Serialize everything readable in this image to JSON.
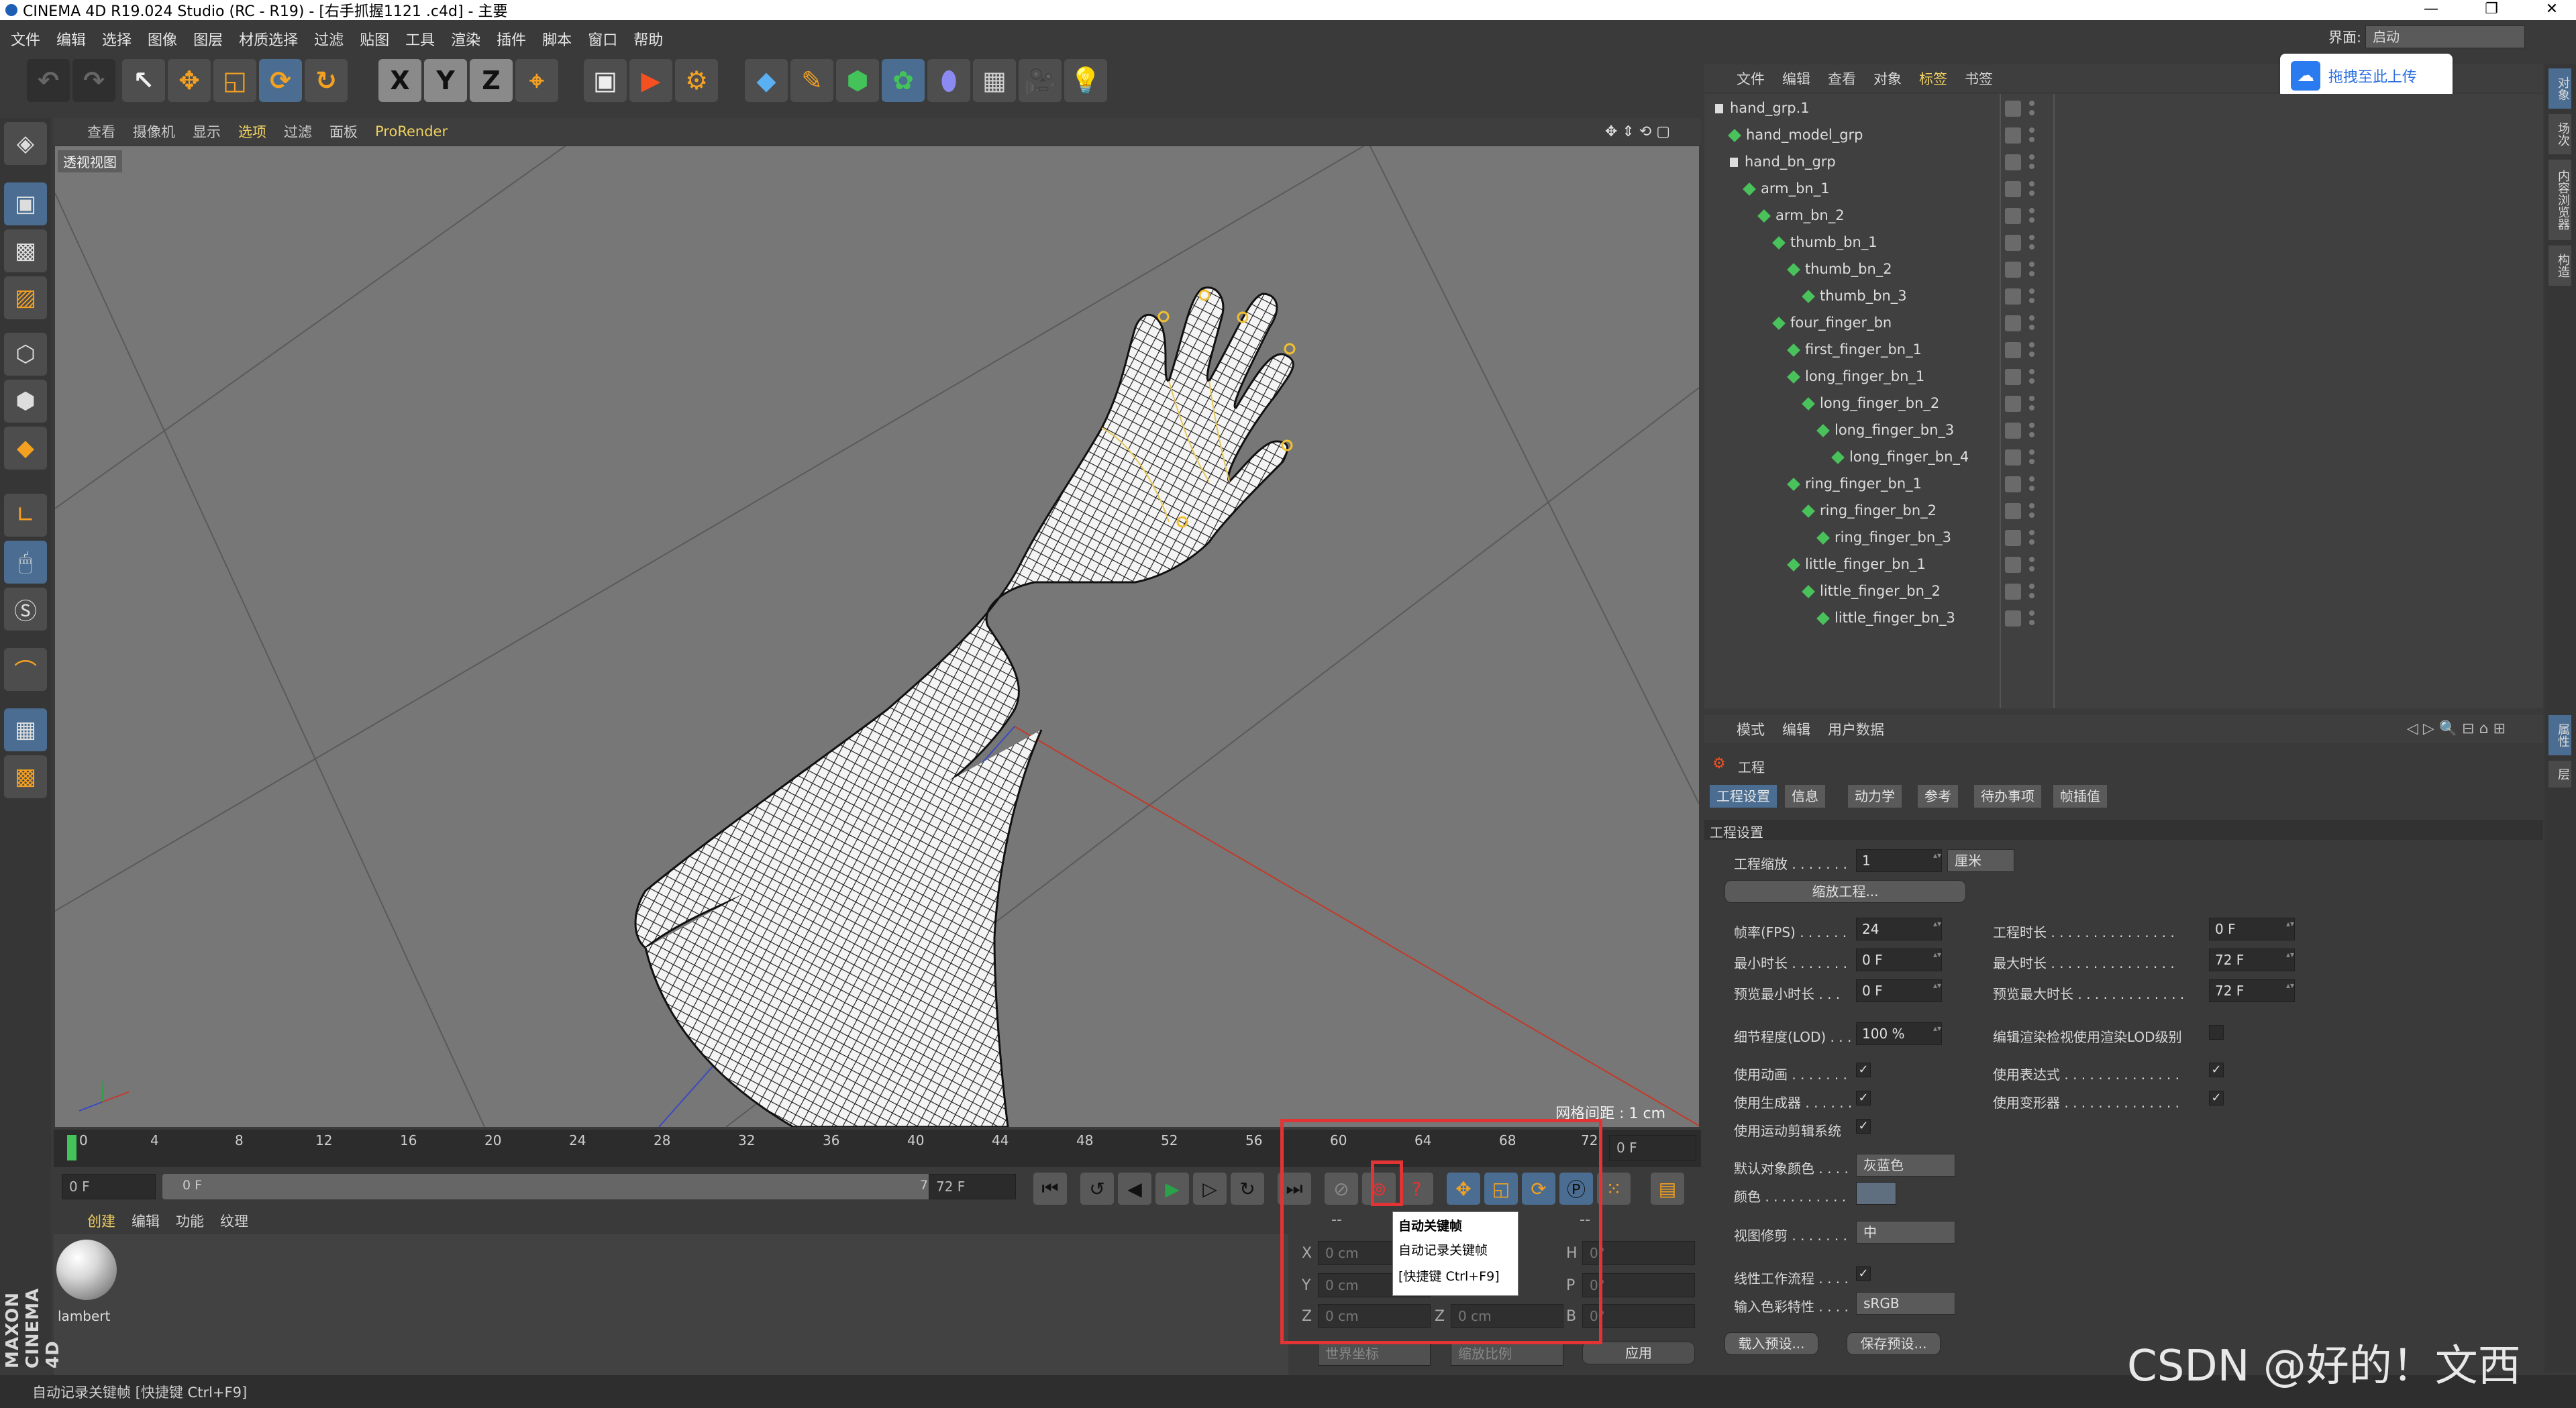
{
  "window": {
    "title": "CINEMA 4D R19.024 Studio (RC - R19) - [右手抓握1121 .c4d] - 主要",
    "minimize": "—",
    "restore": "❐",
    "close": "✕"
  },
  "menubar": [
    "文件",
    "编辑",
    "选择",
    "图像",
    "图层",
    "材质选择",
    "过滤",
    "贴图",
    "工具",
    "渲染",
    "插件",
    "脚本",
    "窗口",
    "帮助"
  ],
  "layout": {
    "label": "界面:",
    "value": "启动"
  },
  "upload_button": "拖拽至此上传",
  "toolbar": {
    "x": "X",
    "y": "Y",
    "z": "Z"
  },
  "viewport": {
    "menu": [
      "查看",
      "摄像机",
      "显示",
      "选项",
      "过滤",
      "面板",
      "ProRender"
    ],
    "label": "透视视图",
    "grid_spacing": "网格间距 : 1 cm"
  },
  "timeline": {
    "ticks": [
      "0",
      "4",
      "8",
      "12",
      "16",
      "20",
      "24",
      "28",
      "32",
      "36",
      "40",
      "44",
      "48",
      "52",
      "56",
      "60",
      "64",
      "68",
      "72"
    ],
    "current_frame": "0 F",
    "start_field": "0 F",
    "range_start": "0 F",
    "range_end": "72 F",
    "end_field": "72 F"
  },
  "material_manager": {
    "menu": [
      "创建",
      "编辑",
      "功能",
      "纹理"
    ],
    "material_name": "lambert",
    "brand": "MAXON CINEMA 4D"
  },
  "coordinates": {
    "header_left": "--",
    "header_right": "--",
    "rows": [
      {
        "a": "X",
        "a_val": "0 cm",
        "b": "H",
        "b_val": "0°"
      },
      {
        "a": "Y",
        "a_val": "0 cm",
        "b": "P",
        "b_val": "0°"
      },
      {
        "a": "Z",
        "a_val": "0 cm",
        "b": "B",
        "b_val": "0°"
      }
    ],
    "extra_z_label": "Z",
    "extra_z_val": "0 cm",
    "mode1": "世界坐标",
    "mode2": "缩放比例",
    "apply": "应用"
  },
  "tooltip": {
    "line1": "自动关键帧",
    "line2": "自动记录关键帧",
    "line3": "[快捷键 Ctrl+F9]"
  },
  "status": "自动记录关键帧 [快捷键 Ctrl+F9]",
  "object_manager": {
    "menu": [
      "文件",
      "编辑",
      "查看",
      "对象",
      "标签",
      "书签"
    ],
    "items": [
      {
        "name": "hand_grp.1",
        "indent": 0,
        "kind": "null"
      },
      {
        "name": "hand_model_grp",
        "indent": 1,
        "kind": "mesh"
      },
      {
        "name": "hand_bn_grp",
        "indent": 1,
        "kind": "null"
      },
      {
        "name": "arm_bn_1",
        "indent": 2,
        "kind": "bone"
      },
      {
        "name": "arm_bn_2",
        "indent": 3,
        "kind": "bone"
      },
      {
        "name": "thumb_bn_1",
        "indent": 4,
        "kind": "bone"
      },
      {
        "name": "thumb_bn_2",
        "indent": 5,
        "kind": "bone"
      },
      {
        "name": "thumb_bn_3",
        "indent": 6,
        "kind": "bone"
      },
      {
        "name": "four_finger_bn",
        "indent": 4,
        "kind": "bone"
      },
      {
        "name": "first_finger_bn_1",
        "indent": 5,
        "kind": "bone"
      },
      {
        "name": "long_finger_bn_1",
        "indent": 5,
        "kind": "bone"
      },
      {
        "name": "long_finger_bn_2",
        "indent": 6,
        "kind": "bone"
      },
      {
        "name": "long_finger_bn_3",
        "indent": 7,
        "kind": "bone"
      },
      {
        "name": "long_finger_bn_4",
        "indent": 8,
        "kind": "bone"
      },
      {
        "name": "ring_finger_bn_1",
        "indent": 5,
        "kind": "bone"
      },
      {
        "name": "ring_finger_bn_2",
        "indent": 6,
        "kind": "bone"
      },
      {
        "name": "ring_finger_bn_3",
        "indent": 7,
        "kind": "bone"
      },
      {
        "name": "little_finger_bn_1",
        "indent": 5,
        "kind": "bone"
      },
      {
        "name": "little_finger_bn_2",
        "indent": 6,
        "kind": "bone"
      },
      {
        "name": "little_finger_bn_3",
        "indent": 7,
        "kind": "bone"
      }
    ]
  },
  "side_tabs": [
    "对象",
    "场次",
    "内容浏览器",
    "构造",
    "属性",
    "层"
  ],
  "attributes": {
    "menu": [
      "模式",
      "编辑",
      "用户数据"
    ],
    "title": "工程",
    "tabs": [
      "工程设置",
      "信息",
      "动力学",
      "参考",
      "待办事项",
      "帧插值"
    ],
    "section": "工程设置",
    "scale_label": "工程缩放 . . . . . . .",
    "scale_value": "1",
    "scale_unit": "厘米",
    "scale_button": "缩放工程...",
    "fps_label": "帧率(FPS) . . . . . .",
    "fps_value": "24",
    "duration_label": "工程时长 . . . . . . . . . . . . . . .",
    "duration_value": "0 F",
    "min_label": "最小时长 . . . . . . .",
    "min_value": "0 F",
    "max_label": "最大时长 . . . . . . . . . . . . . . .",
    "max_value": "72 F",
    "pmin_label": "预览最小时长 . . .",
    "pmin_value": "0 F",
    "pmax_label": "预览最大时长 . . . . . . . . . . . . .",
    "pmax_value": "72 F",
    "lod_label": "细节程度(LOD) . . .",
    "lod_value": "100 %",
    "lod_check_label": "编辑渲染检视使用渲染LOD级别",
    "use_anim": "使用动画 . . . . . . .",
    "use_expr": "使用表达式 . . . . . . . . . . . . . .",
    "use_gen": "使用生成器 . . . . . .",
    "use_deform": "使用变形器 . . . . . . . . . . . . . .",
    "use_motion": "使用运动剪辑系统",
    "def_color_label": "默认对象颜色 . . . .",
    "def_color_value": "灰蓝色",
    "color_label": "颜色 . . . . . . . . . .",
    "view_clip_label": "视图修剪 . . . . . . .",
    "view_clip_value": "中",
    "linear_label": "线性工作流程 . . . .",
    "input_color_label": "输入色彩特性 . . . .",
    "input_color_value": "sRGB",
    "load_preset": "载入预设...",
    "save_preset": "保存预设..."
  },
  "watermark": "CSDN @好的！文西"
}
